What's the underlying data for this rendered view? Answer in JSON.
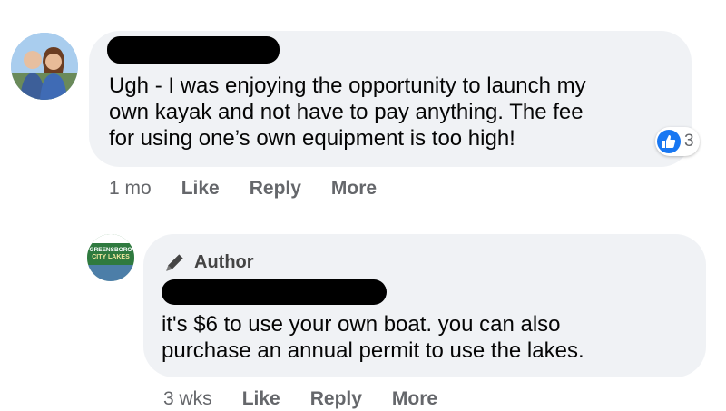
{
  "comment1": {
    "author_name": "[redacted]",
    "text_lines": [
      "Ugh - I was enjoying the opportunity to launch my",
      "own kayak and not have to pay anything. The fee",
      "for using one’s own equipment is too high!"
    ],
    "reaction_count": "3",
    "meta": {
      "time": "1 mo",
      "like": "Like",
      "reply": "Reply",
      "more": "More"
    }
  },
  "comment2": {
    "avatar_text_line1": "GREENSBORO",
    "avatar_text_line2": "CITY LAKES",
    "badge": "Author",
    "author_name": "[redacted]",
    "text_lines": [
      "it's $6 to use your own boat. you can also",
      "purchase an annual permit to use the lakes."
    ],
    "meta": {
      "time": "3 wks",
      "like": "Like",
      "reply": "Reply",
      "more": "More"
    }
  },
  "icons": {
    "reaction": "like-thumbs-up-icon",
    "author_badge": "pen-icon"
  },
  "colors": {
    "bubble_bg": "#f0f2f5",
    "like_blue": "#1877f2",
    "meta_gray": "#65676b"
  }
}
